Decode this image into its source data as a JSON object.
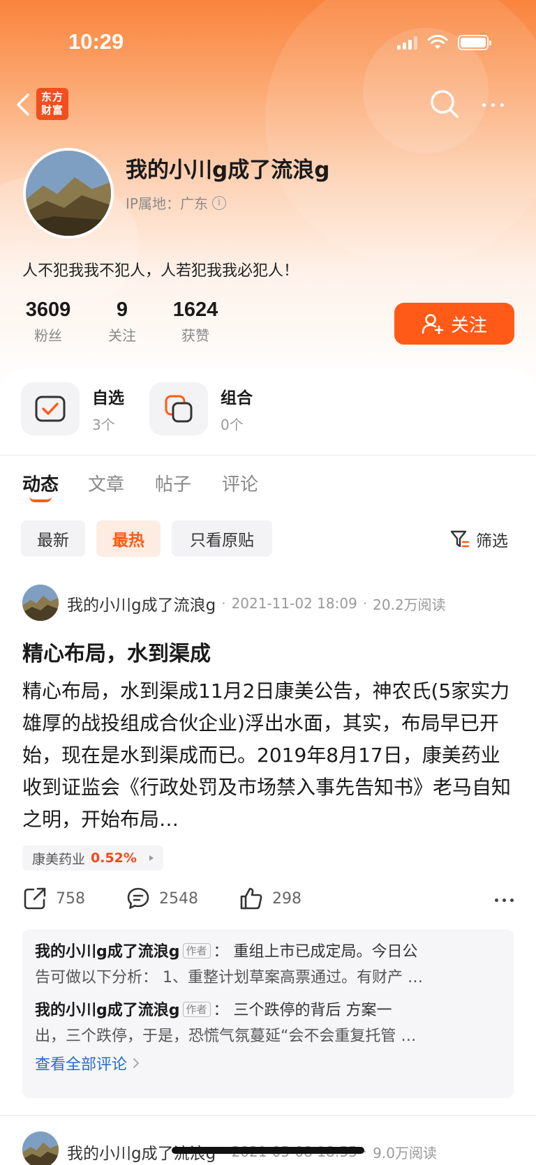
{
  "status_bar": {
    "time": "10:29"
  },
  "nav": {
    "logo_text": "东方\n财富",
    "logo_line1": "东方",
    "logo_line2": "财富"
  },
  "profile": {
    "name": "我的小川g成了流浪g",
    "ip_label": "IP属地：广东",
    "bio": "人不犯我我不犯人，人若犯我我必犯人！",
    "stats": [
      {
        "value": "3609",
        "label": "粉丝"
      },
      {
        "value": "9",
        "label": "关注"
      },
      {
        "value": "1624",
        "label": "获赞"
      }
    ],
    "follow_label": "关注"
  },
  "quick_links": [
    {
      "title": "自选",
      "sub": "3个"
    },
    {
      "title": "组合",
      "sub": "0个"
    }
  ],
  "tabs": [
    {
      "label": "动态",
      "active": true
    },
    {
      "label": "文章",
      "active": false
    },
    {
      "label": "帖子",
      "active": false
    },
    {
      "label": "评论",
      "active": false
    }
  ],
  "chips": [
    {
      "label": "最新",
      "active": false
    },
    {
      "label": "最热",
      "active": true
    },
    {
      "label": "只看原贴",
      "active": false
    }
  ],
  "filter_label": "筛选",
  "posts": [
    {
      "author": "我的小川g成了流浪g",
      "datetime": "2021-11-02 18:09",
      "reads": "20.2万阅读",
      "title": "精心布局，水到渠成",
      "body": "精心布局，水到渠成11月2日康美公告，神农氏(5家实力雄厚的战投组成合伙企业)浮出水面，其实，布局早已开始，现在是水到渠成而已。2019年8月17日，康美药业收到证监会《行政处罚及市场禁入事先告知书》老马自知之明，开始布局…",
      "stock_name": "康美药业",
      "stock_change": "0.52%",
      "shares": "758",
      "comments_count": "2548",
      "likes": "298",
      "comments": [
        {
          "author": "我的小川g成了流浪g",
          "tag": "作者",
          "line1": "：  重组上市已成定局。今日公",
          "line2": "告可做以下分析：   1、重整计划草案高票通过。有财产 …"
        },
        {
          "author": "我的小川g成了流浪g",
          "tag": "作者",
          "line1": "：  三个跌停的背后     方案一",
          "line2": "出，三个跌停，于是，恐慌气氛蔓延“会不会重复托管   …"
        }
      ],
      "view_all": "查看全部评论"
    },
    {
      "author": "我的小川g成了流浪g",
      "datetime": "2021-05-08 18:55",
      "reads": "9.0万阅读"
    }
  ],
  "colors": {
    "accent": "#ff5a17",
    "link": "#2a6ad6",
    "stock_up": "#ee4a1c"
  },
  "icons": [
    "back-icon",
    "search-icon",
    "more-icon",
    "info-icon",
    "add-user-icon",
    "watchlist-icon",
    "portfolio-icon",
    "filter-icon",
    "share-icon",
    "comment-icon",
    "like-icon"
  ]
}
